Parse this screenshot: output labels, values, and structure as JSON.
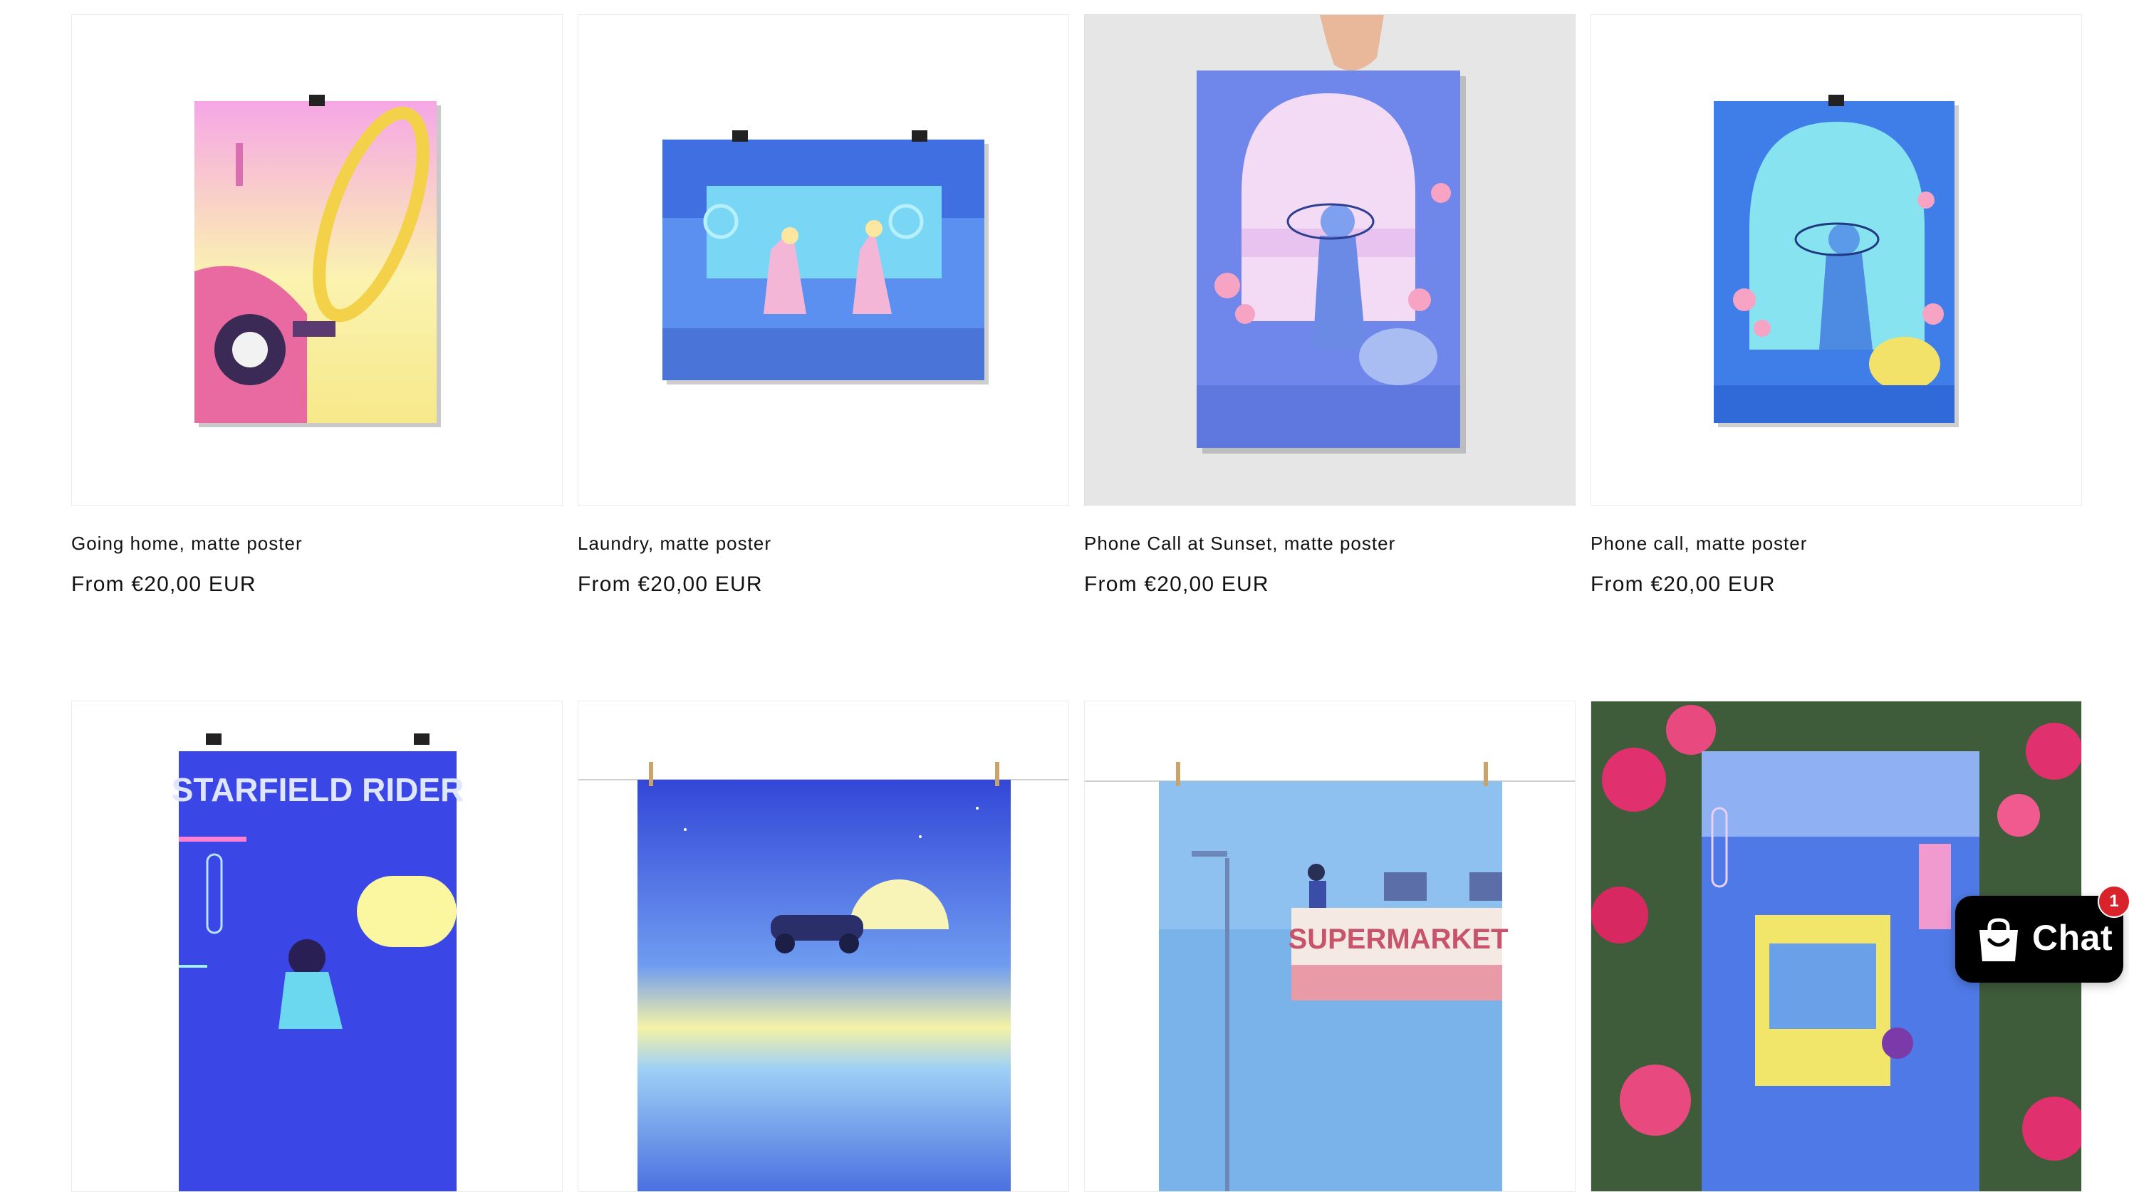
{
  "products": [
    {
      "title": "Going home, matte poster",
      "price": "From €20,00 EUR",
      "image": "going-home-poster-image"
    },
    {
      "title": "Laundry, matte poster",
      "price": "From €20,00 EUR",
      "image": "laundry-poster-image"
    },
    {
      "title": "Phone Call at Sunset, matte poster",
      "price": "From €20,00 EUR",
      "image": "phone-call-sunset-poster-image"
    },
    {
      "title": "Phone call, matte poster",
      "price": "From €20,00 EUR",
      "image": "phone-call-poster-image"
    },
    {
      "image": "starfield-rider-poster-image",
      "poster_text": "STARFIELD RIDER"
    },
    {
      "image": "night-drive-poster-image"
    },
    {
      "image": "supermarket-poster-image",
      "poster_text": "SUPERMARKET"
    },
    {
      "image": "city-street-poster-with-flowers-image"
    }
  ],
  "chat": {
    "label": "Chat",
    "badge": "1",
    "icon": "shopping-bag-icon"
  },
  "colors": {
    "text": "#121212",
    "card_border": "#ececec",
    "chat_bg": "#000000",
    "badge": "#d8232a"
  }
}
